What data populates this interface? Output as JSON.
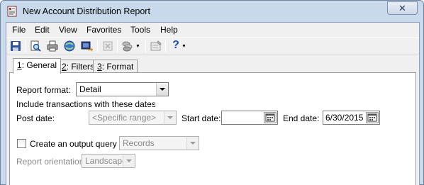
{
  "window": {
    "title": "New Account Distribution Report",
    "close_glyph": "✕"
  },
  "menu": [
    "File",
    "Edit",
    "View",
    "Favorites",
    "Tools",
    "Help"
  ],
  "toolbar": {
    "icons": [
      "save-icon",
      "print-preview-icon",
      "print-icon",
      "web-icon",
      "export-icon",
      "delete-icon",
      "coins-icon",
      "properties-icon",
      "help-icon"
    ],
    "help_glyph": "?"
  },
  "tabs": [
    {
      "accel": "1",
      "label": ": General",
      "active": true
    },
    {
      "accel": "2",
      "label": ": Filters",
      "active": false
    },
    {
      "accel": "3",
      "label": ": Format",
      "active": false
    }
  ],
  "general": {
    "report_format_label": "Report format:",
    "report_format_value": "Detail",
    "section_label": "Include transactions with these dates",
    "post_date_label": "Post date:",
    "post_date_value": "<Specific range>",
    "start_date_label": "Start date:",
    "start_date_value": "",
    "end_date_label": "End date:",
    "end_date_value": "6/30/2015",
    "output_query_label": "Create an output query of",
    "output_query_checked": false,
    "output_query_value": "Records",
    "orientation_label": "Report orientation:",
    "orientation_value": "Landscape"
  },
  "colors": {
    "window_frame": "#c9d9ec",
    "client_bg": "#f0f0f0",
    "disabled_text": "#8a8a8a"
  }
}
